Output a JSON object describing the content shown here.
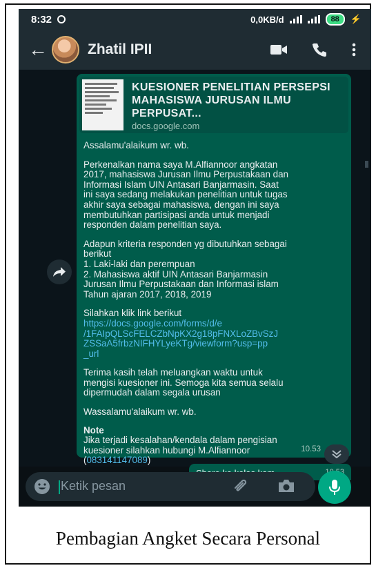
{
  "status_bar": {
    "time": "8:32",
    "net_speed": "0,0KB/d",
    "battery": "88"
  },
  "header": {
    "back_label": "←",
    "contact_name": "Zhatil IPII"
  },
  "message": {
    "link_preview": {
      "title": "KUESIONER PENELITIAN PERSEPSI MAHASISWA JURUSAN ILMU PERPUSAT...",
      "domain": "docs.google.com"
    },
    "greeting": "Assalamu'alaikum wr. wb.",
    "intro": "Perkenalkan nama saya M.Alfiannoor angkatan\n2017, mahasiswa Jurusan Ilmu Perpustakaan dan\nInformasi Islam UIN Antasari Banjarmasin. Saat\nini saya sedang melakukan penelitian untuk tugas\nakhir saya sebagai mahasiswa, dengan ini saya\nmembutuhkan partisipasi anda untuk menjadi\nresponden dalam penelitian saya.",
    "criteria": "Adapun kriteria responden yg dibutuhkan sebagai\nberikut\n1. Laki-laki dan perempuan\n2. Mahasiswa aktif UIN Antasari Banjarmasin\nJurusan Ilmu Perpustakaan dan Informasi islam\nTahun ajaran 2017, 2018, 2019",
    "link_intro": "Silahkan klik link berikut",
    "link": "https://docs.google.com/forms/d/e\n/1FAIpQLScFELCZbNpKX2g18pFNXLoZBvSzJ\nZSSaA5frbzNIFHYLyeKTg/viewform?usp=pp\n_url",
    "thanks": "Terima kasih telah meluangkan waktu untuk\nmengisi kuesioner ini. Semoga kita semua selalu\ndipermudah dalam segala urusan",
    "closing": "Wassalamu'alaikum wr. wb.",
    "note_label": "Note",
    "note_text": "Jika terjadi kesalahan/kendala dalam pengisian\nkuesioner silahkan hubungi M.Alfiannoor\n(",
    "note_phone": "083141147089",
    "note_end": ")",
    "time": "10.53"
  },
  "reply": {
    "text": "Share ke kelas kam",
    "time": "10.53"
  },
  "input": {
    "placeholder": "Ketik pesan"
  },
  "caption": "Pembagian Angket Secara Personal",
  "colors": {
    "bubble": "#005c4b",
    "accent": "#00a884",
    "link": "#53bdeb",
    "header": "#1f2c33"
  },
  "icons": [
    "back-arrow-icon",
    "video-call-icon",
    "phone-call-icon",
    "more-vert-icon",
    "forward-icon",
    "scroll-down-icon",
    "emoji-icon",
    "attach-icon",
    "camera-icon",
    "mic-icon"
  ]
}
